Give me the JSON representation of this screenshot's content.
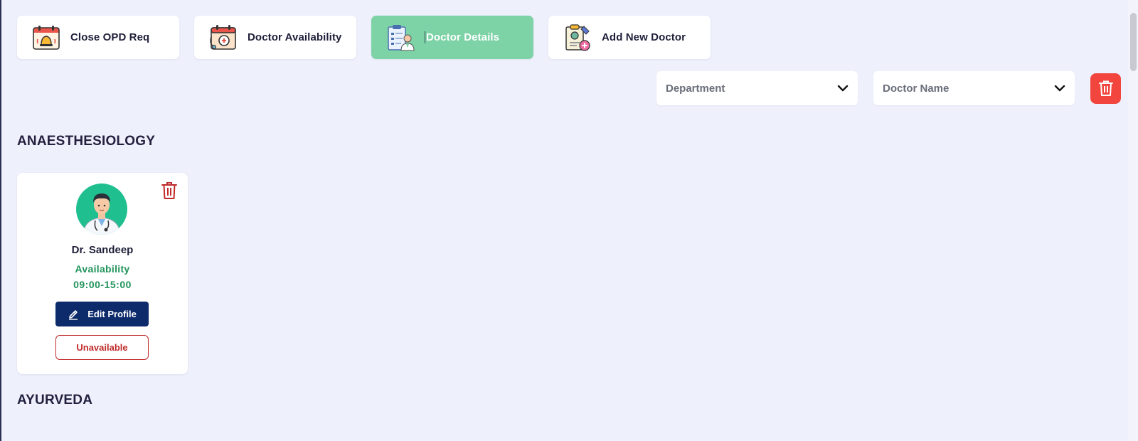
{
  "tabs": [
    {
      "label": "Close OPD Req",
      "icon": "alarm-calendar-icon",
      "active": false
    },
    {
      "label": "Doctor Availability",
      "icon": "calendar-stethoscope-icon",
      "active": false
    },
    {
      "label": "Doctor Details",
      "icon": "clipboard-doctor-icon",
      "active": true
    },
    {
      "label": "Add New Doctor",
      "icon": "add-doctor-clipboard-icon",
      "active": false
    }
  ],
  "filters": {
    "department": {
      "value": "Department"
    },
    "doctor_name": {
      "value": "Doctor Name"
    },
    "clear_icon": "trash-icon"
  },
  "sections": [
    {
      "title": "ANAESTHESIOLOGY",
      "doctors": [
        {
          "name": "Dr. Sandeep",
          "availability_label": "Availability",
          "availability_time": "09:00-15:00",
          "edit_label": "Edit Profile",
          "unavailable_label": "Unavailable"
        }
      ]
    },
    {
      "title": "AYURVEDA",
      "doctors": []
    }
  ],
  "colors": {
    "background": "#eef0fc",
    "active_tab": "#7dd3a6",
    "primary_button": "#0d2a6b",
    "danger": "#f1453d",
    "availability_text": "#20935a",
    "unavailable_border": "#c02a2a"
  }
}
